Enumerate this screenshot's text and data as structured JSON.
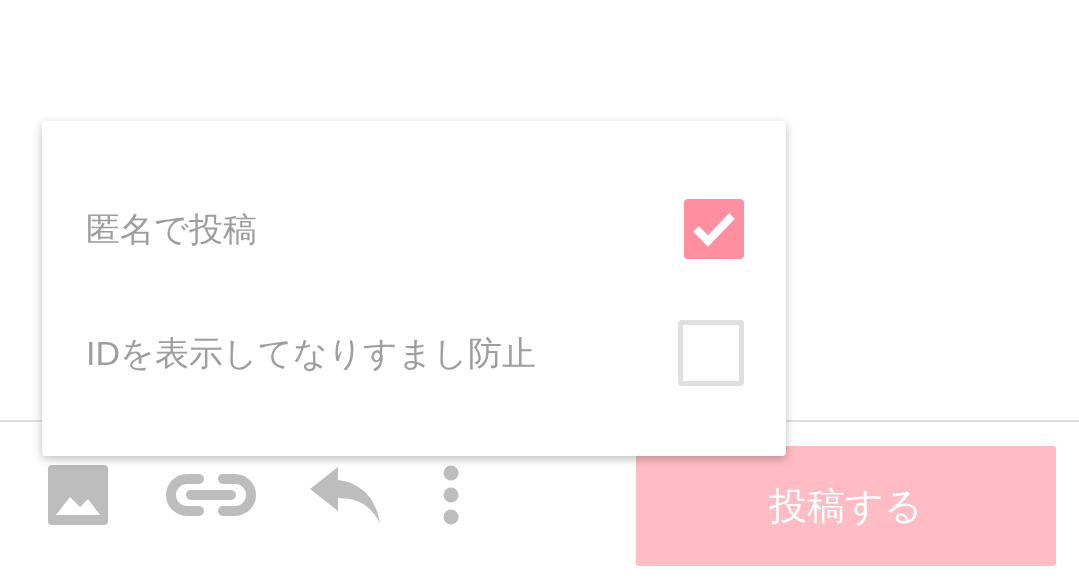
{
  "menu": {
    "options": [
      {
        "label": "匿名で投稿",
        "checked": true
      },
      {
        "label": "IDを表示してなりすまし防止",
        "checked": false
      }
    ]
  },
  "toolbar": {
    "post_button": "投稿する"
  }
}
